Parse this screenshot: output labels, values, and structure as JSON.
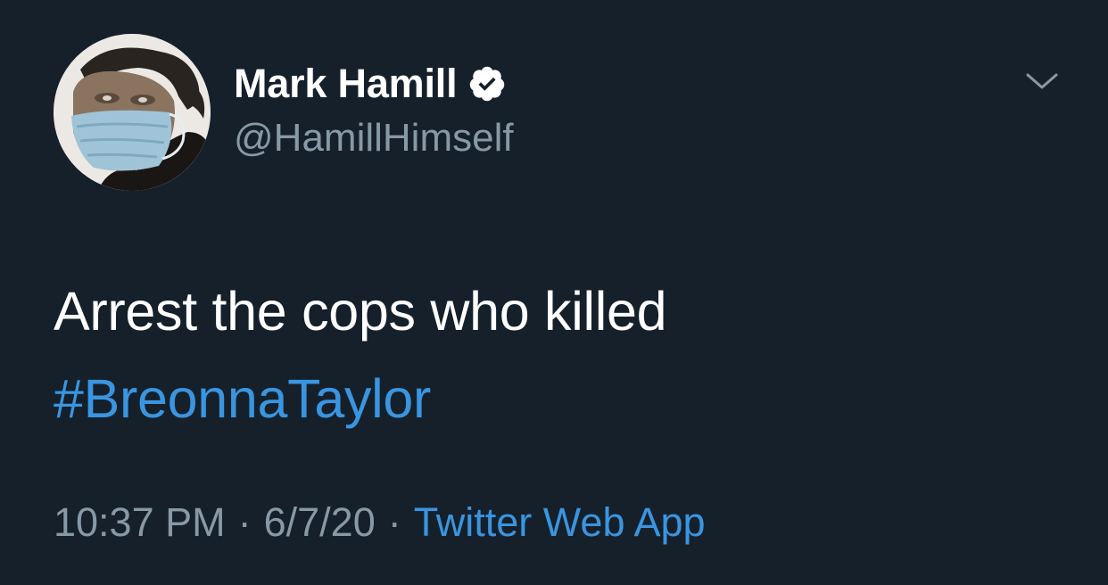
{
  "user": {
    "display_name": "Mark Hamill",
    "handle": "@HamillHimself",
    "verified": true,
    "avatar": "profile-photo-man-wearing-surgical-mask"
  },
  "tweet": {
    "text_line1": "Arrest the cops who killed",
    "hashtag": "#BreonnaTaylor",
    "time": "10:37 PM",
    "separator": "·",
    "date": "6/7/20",
    "source": "Twitter Web App"
  },
  "icons": {
    "menu": "chevron-down-icon",
    "verified": "verified-badge-icon"
  },
  "colors": {
    "background": "#15202b",
    "text_primary": "#ffffff",
    "text_secondary": "#8899a6",
    "link": "#3a95e0"
  }
}
